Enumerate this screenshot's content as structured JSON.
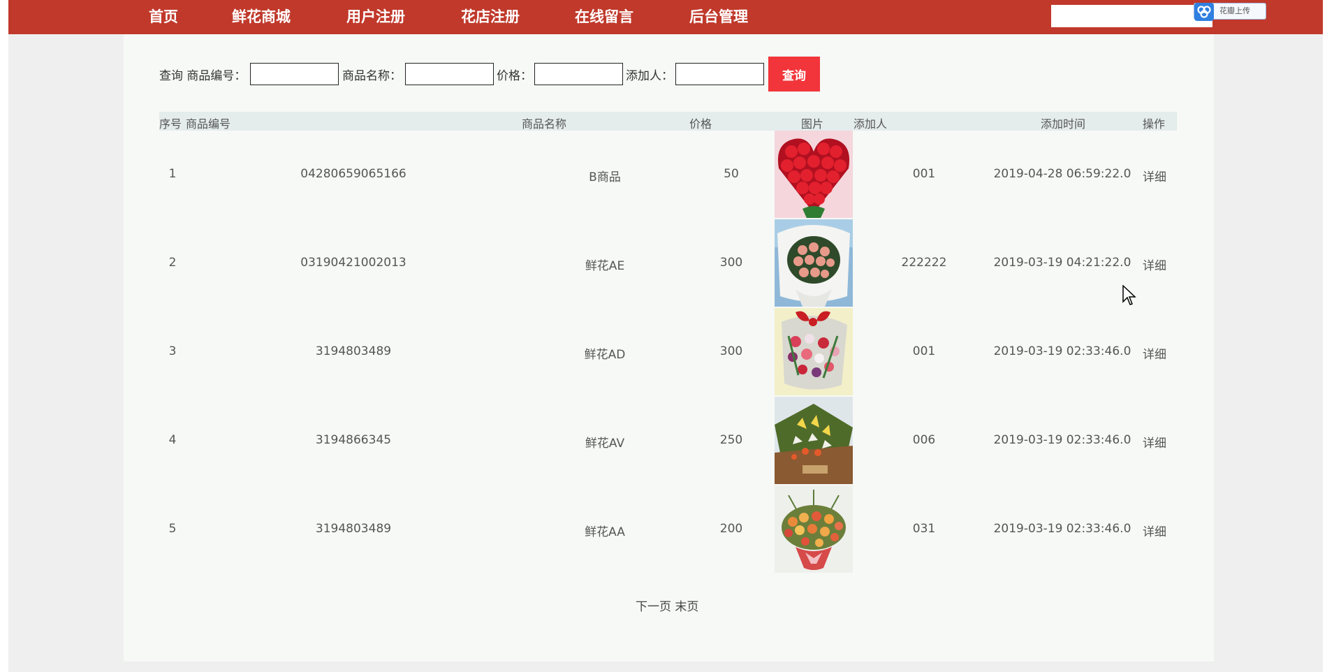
{
  "nav": {
    "items": [
      "首页",
      "鲜花商城",
      "用户注册",
      "花店注册",
      "在线留言",
      "后台管理"
    ],
    "search_value": "",
    "upload_label": "花瓣上传"
  },
  "search": {
    "prefix": "查询",
    "fields": [
      {
        "label": "商品编号：",
        "value": ""
      },
      {
        "label": "商品名称：",
        "value": ""
      },
      {
        "label": "价格：",
        "value": ""
      },
      {
        "label": "添加人：",
        "value": ""
      }
    ],
    "button": "查询"
  },
  "table": {
    "headers": [
      "序号",
      "商品编号",
      "商品名称",
      "价格",
      "图片",
      "添加人",
      "添加时间",
      "操作"
    ],
    "rows": [
      {
        "index": "1",
        "code": "04280659065166",
        "name": "B商品",
        "price": "50",
        "image": "red-rose-heart-bouquet",
        "adder": "001",
        "time": "2019-04-28 06:59:22.0",
        "action": "详细"
      },
      {
        "index": "2",
        "code": "03190421002013",
        "name": "鲜花AE",
        "price": "300",
        "image": "pink-rose-white-wrap-bouquet",
        "adder": "222222",
        "time": "2019-03-19 04:21:22.0",
        "action": "详细"
      },
      {
        "index": "3",
        "code": "3194803489",
        "name": "鲜花AD",
        "price": "300",
        "image": "mixed-bouquet-red-bow",
        "adder": "001",
        "time": "2019-03-19 02:33:46.0",
        "action": "详细"
      },
      {
        "index": "4",
        "code": "3194866345",
        "name": "鲜花AV",
        "price": "250",
        "image": "lily-bouquet-green-wrap",
        "adder": "006",
        "time": "2019-03-19 02:33:46.0",
        "action": "详细"
      },
      {
        "index": "5",
        "code": "3194803489",
        "name": "鲜花AA",
        "price": "200",
        "image": "orange-rose-bouquet",
        "adder": "031",
        "time": "2019-03-19 02:33:46.0",
        "action": "详细"
      }
    ]
  },
  "pager": {
    "next": "下一页",
    "last": "末页"
  },
  "colors": {
    "nav_bg": "#c0392b",
    "query_button": "#f2353a",
    "panel_bg": "#f6f9f6",
    "header_bg": "#e4ecec"
  }
}
